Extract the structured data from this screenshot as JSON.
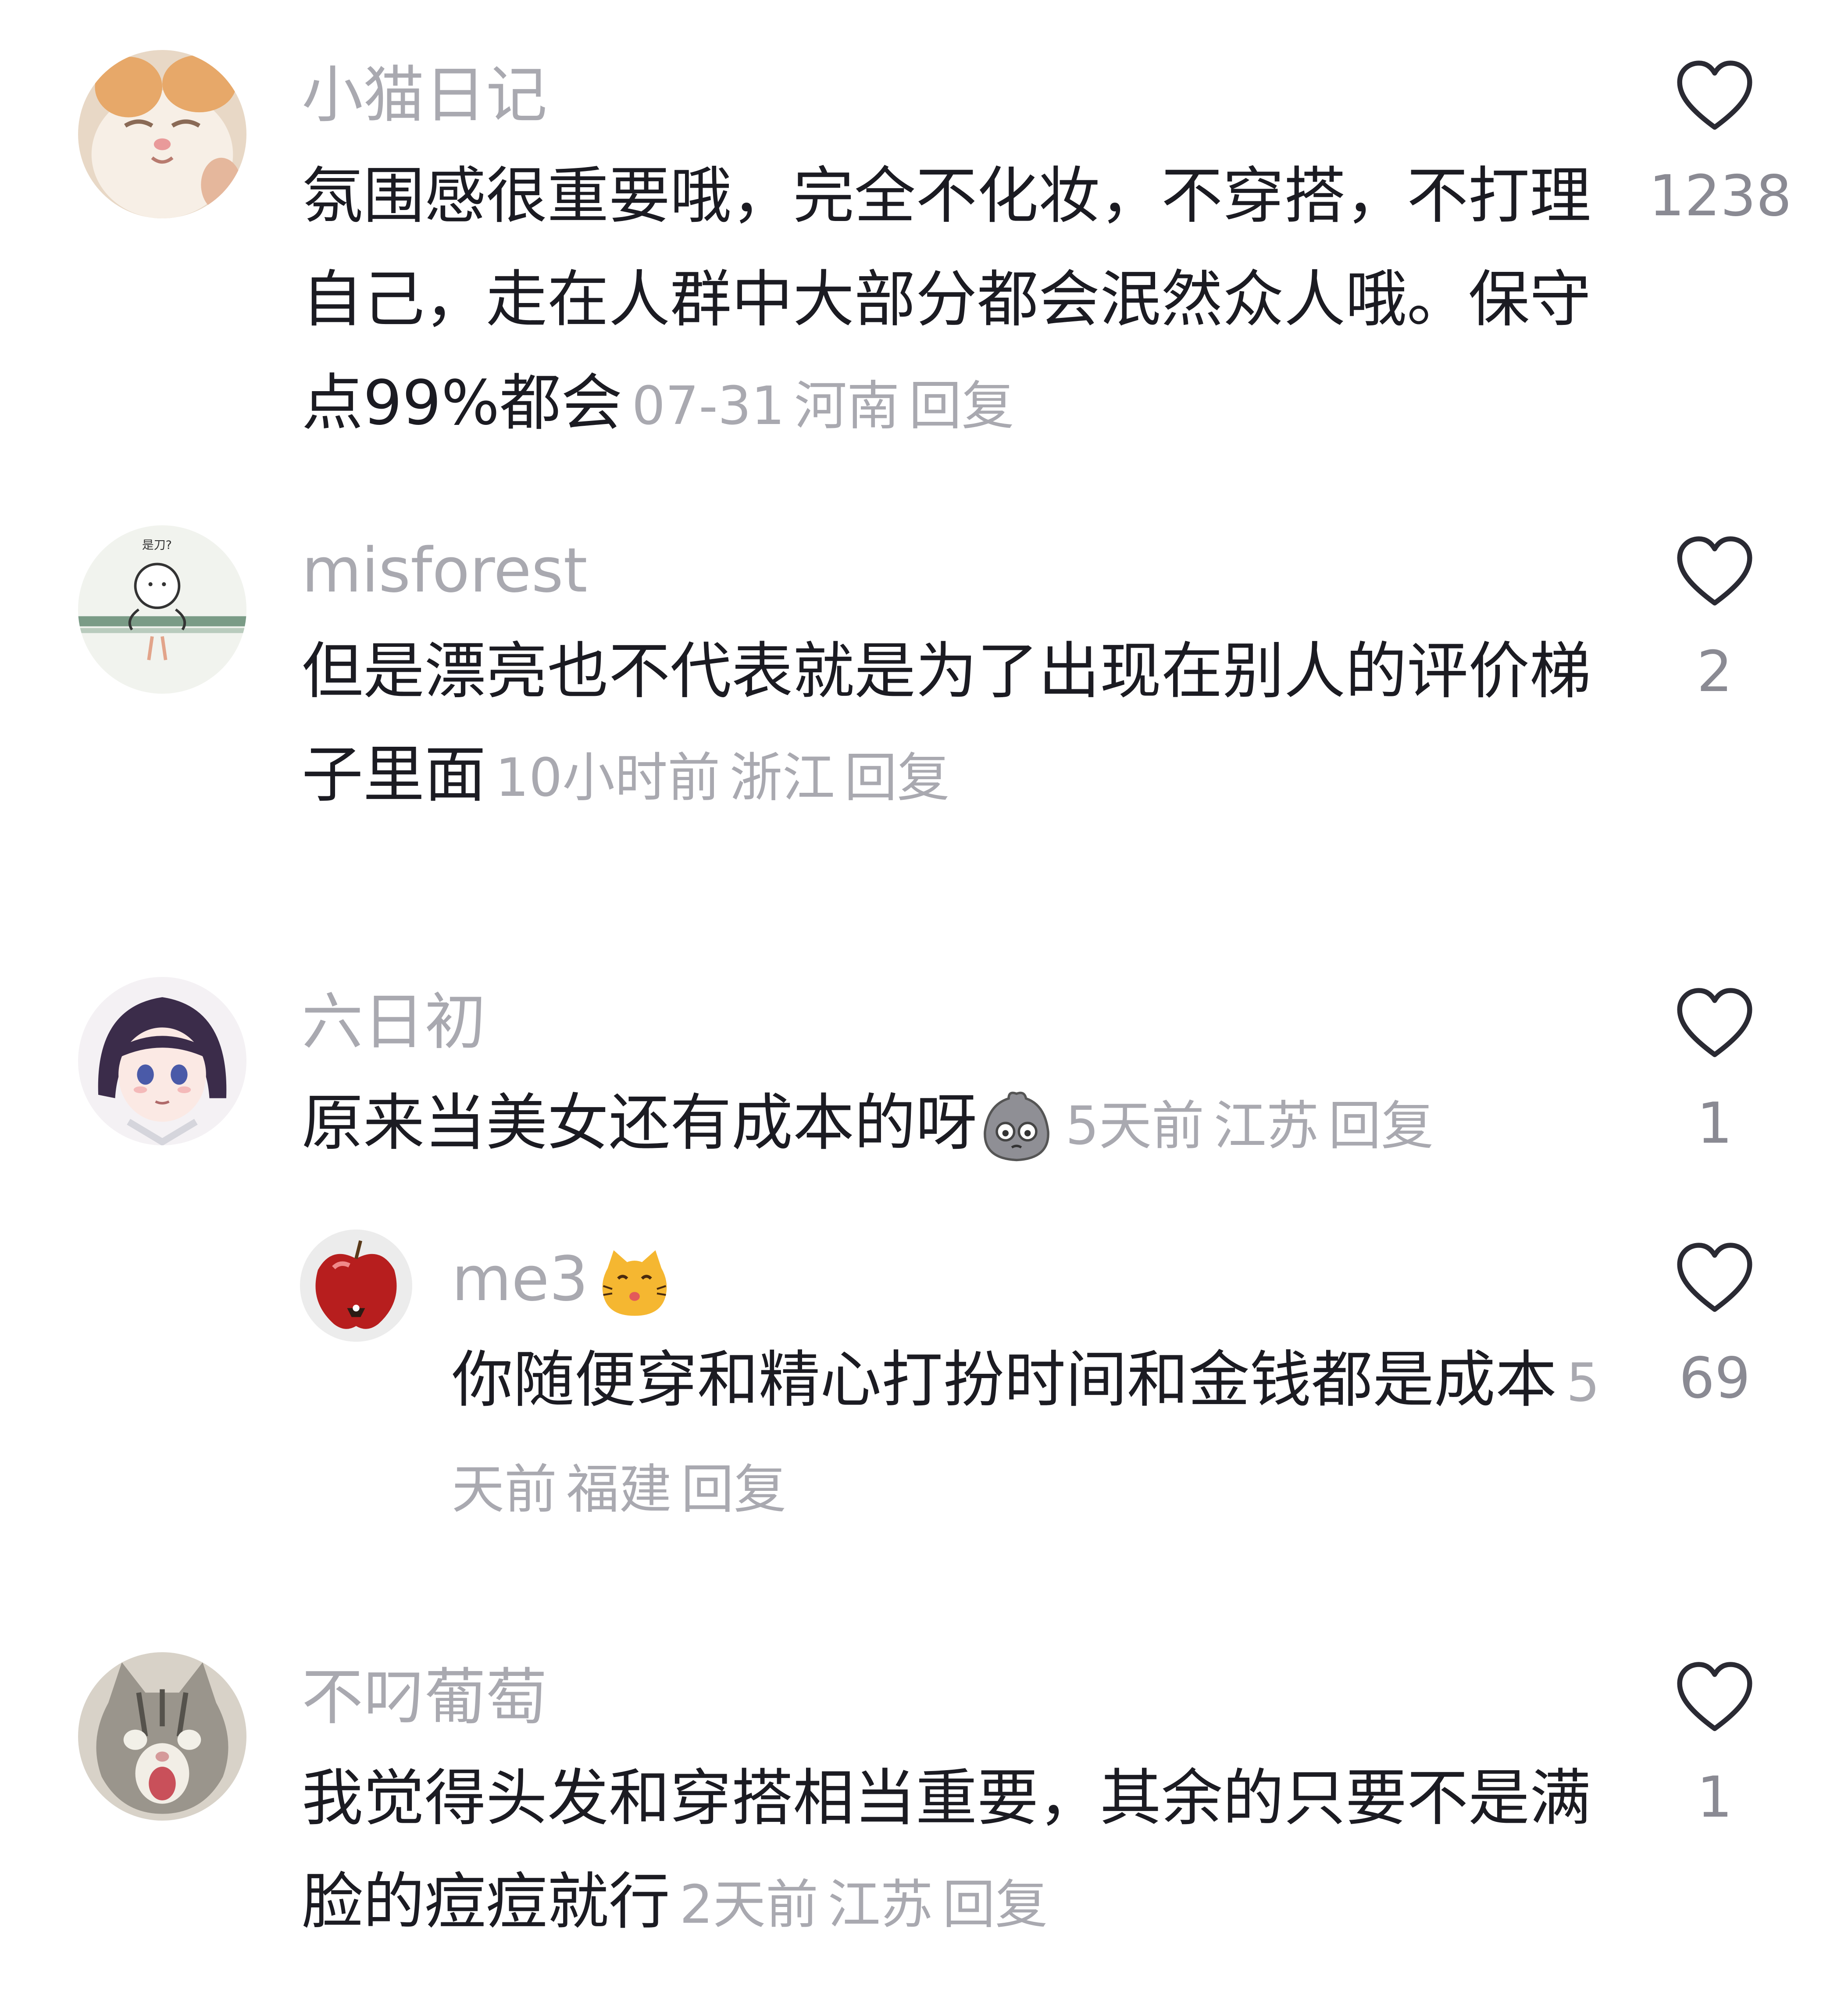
{
  "comments": [
    {
      "username": "小猫日记",
      "text": "氛围感很重要哦，完全不化妆，不穿搭，不打理自己，走在人群中大部分都会泯然众人哦。保守点99%都会",
      "time": "07-31",
      "location": "河南",
      "reply_label": "回复",
      "likes": "1238",
      "avatar_icon": "cat-face-avatar"
    },
    {
      "username": "misforest",
      "text": "但是漂亮也不代表就是为了出现在别人的评价梯子里面",
      "time": "10小时前",
      "location": "浙江",
      "reply_label": "回复",
      "likes": "2",
      "avatar_icon": "doodle-character-avatar",
      "avatar_caption": "是刀?"
    },
    {
      "username": "六日初",
      "text": "原来当美女还有成本的呀",
      "emoji": "pouting-blob-emoji",
      "time": "5天前",
      "location": "江苏",
      "reply_label": "回复",
      "likes": "1",
      "avatar_icon": "anime-girl-avatar",
      "replies": [
        {
          "username": "me3",
          "username_emoji": "kissing-cat-emoji",
          "text": "你随便穿和精心打扮时间和金钱都是成本",
          "time": "5天前",
          "location": "福建",
          "reply_label": "回复",
          "likes": "69",
          "avatar_icon": "red-apple-avatar"
        }
      ]
    },
    {
      "username": "不叼葡萄",
      "text": "我觉得头发和穿搭相当重要，其余的只要不是满脸的痘痘就行",
      "time": "2天前",
      "location": "江苏",
      "reply_label": "回复",
      "likes": "1",
      "avatar_icon": "screaming-cat-avatar"
    }
  ],
  "colors": {
    "text": "#1b1b22",
    "secondary": "#a9a9b0",
    "like_outline": "#2a2a33",
    "background": "#ffffff"
  }
}
